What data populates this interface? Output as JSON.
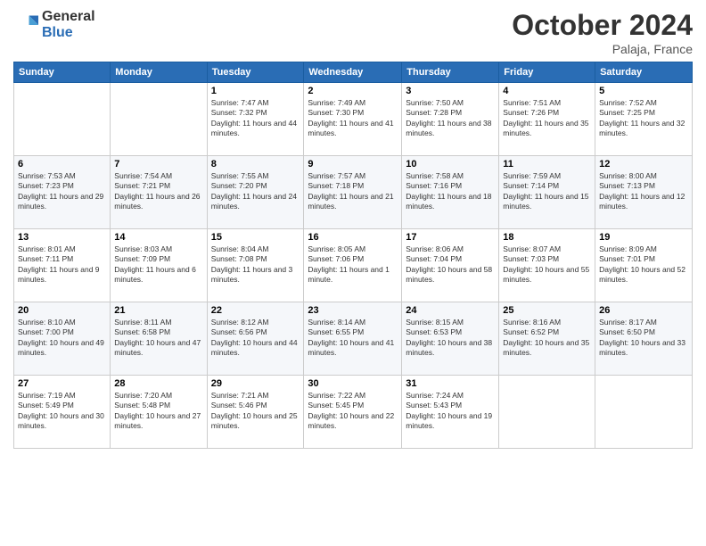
{
  "logo": {
    "general": "General",
    "blue": "Blue"
  },
  "header": {
    "month": "October 2024",
    "location": "Palaja, France"
  },
  "weekdays": [
    "Sunday",
    "Monday",
    "Tuesday",
    "Wednesday",
    "Thursday",
    "Friday",
    "Saturday"
  ],
  "weeks": [
    [
      {
        "day": "",
        "info": ""
      },
      {
        "day": "",
        "info": ""
      },
      {
        "day": "1",
        "info": "Sunrise: 7:47 AM\nSunset: 7:32 PM\nDaylight: 11 hours and 44 minutes."
      },
      {
        "day": "2",
        "info": "Sunrise: 7:49 AM\nSunset: 7:30 PM\nDaylight: 11 hours and 41 minutes."
      },
      {
        "day": "3",
        "info": "Sunrise: 7:50 AM\nSunset: 7:28 PM\nDaylight: 11 hours and 38 minutes."
      },
      {
        "day": "4",
        "info": "Sunrise: 7:51 AM\nSunset: 7:26 PM\nDaylight: 11 hours and 35 minutes."
      },
      {
        "day": "5",
        "info": "Sunrise: 7:52 AM\nSunset: 7:25 PM\nDaylight: 11 hours and 32 minutes."
      }
    ],
    [
      {
        "day": "6",
        "info": "Sunrise: 7:53 AM\nSunset: 7:23 PM\nDaylight: 11 hours and 29 minutes."
      },
      {
        "day": "7",
        "info": "Sunrise: 7:54 AM\nSunset: 7:21 PM\nDaylight: 11 hours and 26 minutes."
      },
      {
        "day": "8",
        "info": "Sunrise: 7:55 AM\nSunset: 7:20 PM\nDaylight: 11 hours and 24 minutes."
      },
      {
        "day": "9",
        "info": "Sunrise: 7:57 AM\nSunset: 7:18 PM\nDaylight: 11 hours and 21 minutes."
      },
      {
        "day": "10",
        "info": "Sunrise: 7:58 AM\nSunset: 7:16 PM\nDaylight: 11 hours and 18 minutes."
      },
      {
        "day": "11",
        "info": "Sunrise: 7:59 AM\nSunset: 7:14 PM\nDaylight: 11 hours and 15 minutes."
      },
      {
        "day": "12",
        "info": "Sunrise: 8:00 AM\nSunset: 7:13 PM\nDaylight: 11 hours and 12 minutes."
      }
    ],
    [
      {
        "day": "13",
        "info": "Sunrise: 8:01 AM\nSunset: 7:11 PM\nDaylight: 11 hours and 9 minutes."
      },
      {
        "day": "14",
        "info": "Sunrise: 8:03 AM\nSunset: 7:09 PM\nDaylight: 11 hours and 6 minutes."
      },
      {
        "day": "15",
        "info": "Sunrise: 8:04 AM\nSunset: 7:08 PM\nDaylight: 11 hours and 3 minutes."
      },
      {
        "day": "16",
        "info": "Sunrise: 8:05 AM\nSunset: 7:06 PM\nDaylight: 11 hours and 1 minute."
      },
      {
        "day": "17",
        "info": "Sunrise: 8:06 AM\nSunset: 7:04 PM\nDaylight: 10 hours and 58 minutes."
      },
      {
        "day": "18",
        "info": "Sunrise: 8:07 AM\nSunset: 7:03 PM\nDaylight: 10 hours and 55 minutes."
      },
      {
        "day": "19",
        "info": "Sunrise: 8:09 AM\nSunset: 7:01 PM\nDaylight: 10 hours and 52 minutes."
      }
    ],
    [
      {
        "day": "20",
        "info": "Sunrise: 8:10 AM\nSunset: 7:00 PM\nDaylight: 10 hours and 49 minutes."
      },
      {
        "day": "21",
        "info": "Sunrise: 8:11 AM\nSunset: 6:58 PM\nDaylight: 10 hours and 47 minutes."
      },
      {
        "day": "22",
        "info": "Sunrise: 8:12 AM\nSunset: 6:56 PM\nDaylight: 10 hours and 44 minutes."
      },
      {
        "day": "23",
        "info": "Sunrise: 8:14 AM\nSunset: 6:55 PM\nDaylight: 10 hours and 41 minutes."
      },
      {
        "day": "24",
        "info": "Sunrise: 8:15 AM\nSunset: 6:53 PM\nDaylight: 10 hours and 38 minutes."
      },
      {
        "day": "25",
        "info": "Sunrise: 8:16 AM\nSunset: 6:52 PM\nDaylight: 10 hours and 35 minutes."
      },
      {
        "day": "26",
        "info": "Sunrise: 8:17 AM\nSunset: 6:50 PM\nDaylight: 10 hours and 33 minutes."
      }
    ],
    [
      {
        "day": "27",
        "info": "Sunrise: 7:19 AM\nSunset: 5:49 PM\nDaylight: 10 hours and 30 minutes."
      },
      {
        "day": "28",
        "info": "Sunrise: 7:20 AM\nSunset: 5:48 PM\nDaylight: 10 hours and 27 minutes."
      },
      {
        "day": "29",
        "info": "Sunrise: 7:21 AM\nSunset: 5:46 PM\nDaylight: 10 hours and 25 minutes."
      },
      {
        "day": "30",
        "info": "Sunrise: 7:22 AM\nSunset: 5:45 PM\nDaylight: 10 hours and 22 minutes."
      },
      {
        "day": "31",
        "info": "Sunrise: 7:24 AM\nSunset: 5:43 PM\nDaylight: 10 hours and 19 minutes."
      },
      {
        "day": "",
        "info": ""
      },
      {
        "day": "",
        "info": ""
      }
    ]
  ]
}
